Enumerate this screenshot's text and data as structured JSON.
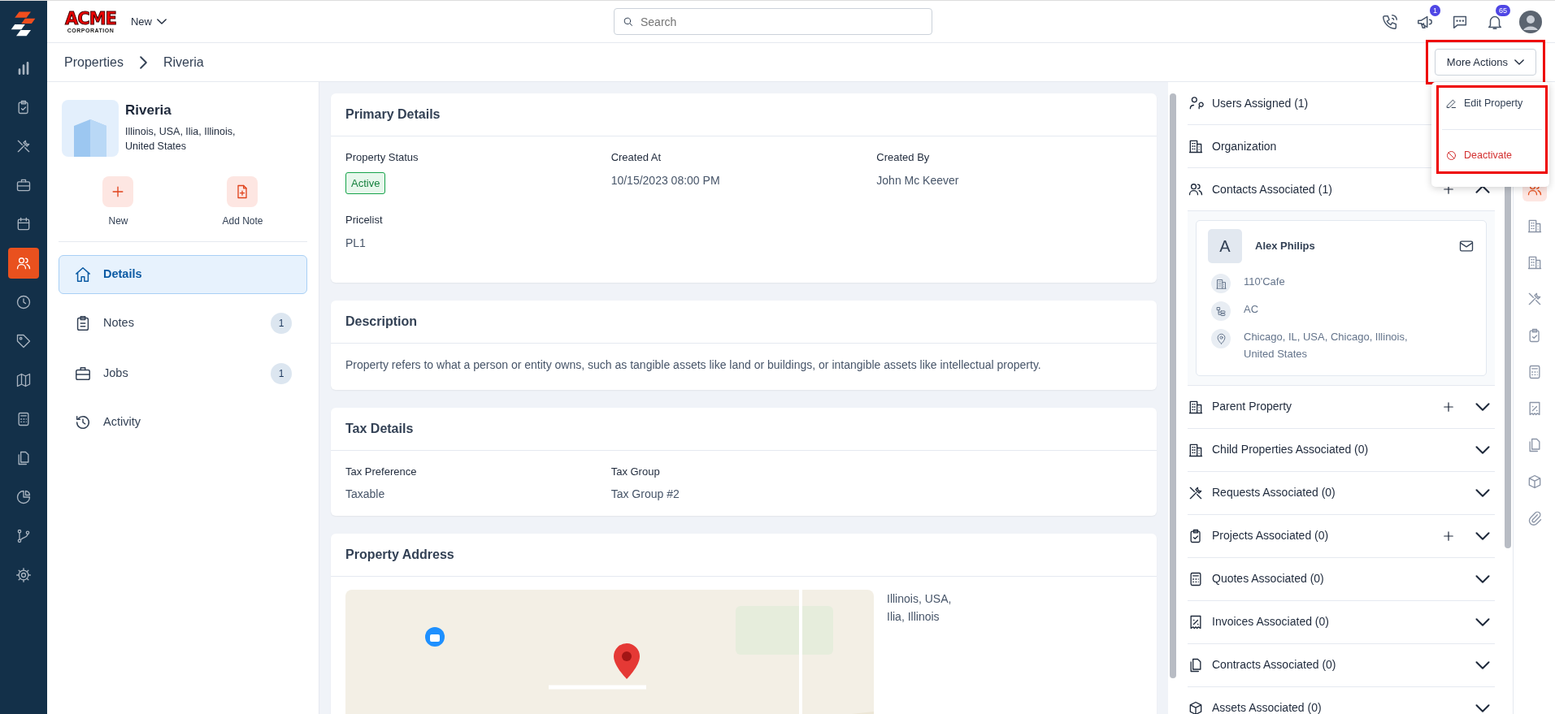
{
  "left_nav": {
    "items": [
      {
        "selected": false
      },
      {
        "selected": false
      },
      {
        "selected": false
      },
      {
        "selected": false
      },
      {
        "selected": false
      },
      {
        "selected": true
      },
      {
        "selected": false
      },
      {
        "selected": false
      },
      {
        "selected": false
      },
      {
        "selected": false
      },
      {
        "selected": false
      },
      {
        "selected": false
      },
      {
        "selected": false
      },
      {
        "selected": false
      }
    ]
  },
  "header": {
    "logo": {
      "text": "ACME",
      "subtext": "CORPORATION"
    },
    "new_menu": "New",
    "search": {
      "placeholder": "Search"
    },
    "icons": [
      {
        "kind": "phone"
      },
      {
        "kind": "megaphone",
        "badge": "1"
      },
      {
        "kind": "chat"
      },
      {
        "kind": "bell",
        "badge": "65"
      }
    ]
  },
  "breadcrumb": [
    "Properties",
    "Riveria"
  ],
  "more_actions": {
    "label": "More Actions",
    "highlighted": true
  },
  "dropdown": {
    "highlighted": true,
    "items": [
      {
        "label": "Edit Property",
        "kind": "normal"
      },
      {
        "label": "Deactivate",
        "kind": "danger"
      }
    ]
  },
  "property": {
    "name": "Riveria",
    "address": "Illinois, USA, Ilia, Illinois, United States"
  },
  "quick_actions": [
    {
      "label": "New"
    },
    {
      "label": "Add Note"
    }
  ],
  "tabs": [
    {
      "label": "Details",
      "selected": true
    },
    {
      "label": "Notes",
      "count": "1",
      "selected": false
    },
    {
      "label": "Jobs",
      "count": "1",
      "selected": false
    },
    {
      "label": "Activity",
      "selected": false
    }
  ],
  "primary_details": {
    "title": "Primary Details",
    "fields": [
      {
        "label": "Property Status",
        "value": "Active",
        "kind": "badge"
      },
      {
        "label": "Created At",
        "value": "10/15/2023 08:00 PM",
        "kind": "text"
      },
      {
        "label": "Created By",
        "value": "John Mc Keever",
        "kind": "text"
      },
      {
        "label": "Pricelist",
        "value": "PL1",
        "kind": "text"
      }
    ]
  },
  "description": {
    "title": "Description",
    "text": "Property refers to what a person or entity owns, such as tangible assets like land or buildings, or intangible assets like intellectual property."
  },
  "tax_details": {
    "title": "Tax Details",
    "fields": [
      {
        "label": "Tax Preference",
        "value": "Taxable"
      },
      {
        "label": "Tax Group",
        "value": "Tax Group #2"
      }
    ]
  },
  "property_address": {
    "title": "Property Address",
    "address": "Illinois, USA, Ilia, Illinois"
  },
  "right_panel": {
    "sections": [
      {
        "title": "Users Assigned (1)",
        "add": false
      },
      {
        "title": "Organization",
        "add": false
      },
      {
        "title": "Contacts Associated (1)",
        "add": true,
        "expanded": true
      },
      {
        "title": "Parent Property",
        "add": true,
        "expanded": false
      },
      {
        "title": "Child Properties Associated (0)",
        "add": false,
        "expanded": false
      },
      {
        "title": "Requests Associated (0)",
        "add": false,
        "expanded": false
      },
      {
        "title": "Projects Associated (0)",
        "add": true,
        "expanded": false
      },
      {
        "title": "Quotes Associated (0)",
        "add": false,
        "expanded": false
      },
      {
        "title": "Invoices Associated (0)",
        "add": false,
        "expanded": false
      },
      {
        "title": "Contracts Associated (0)",
        "add": false,
        "expanded": false
      },
      {
        "title": "Assets Associated (0)",
        "add": false,
        "expanded": false
      }
    ],
    "contact": {
      "initial": "A",
      "name": "Alex Philips",
      "lines": [
        "110'Cafe",
        "AC",
        "Chicago, IL, USA, Chicago, Illinois, United States"
      ]
    }
  },
  "right_rail": {
    "items": [
      {
        "selected": true
      },
      {
        "selected": false
      },
      {
        "selected": false
      },
      {
        "selected": false
      },
      {
        "selected": false
      },
      {
        "selected": false
      },
      {
        "selected": false
      },
      {
        "selected": false
      },
      {
        "selected": false
      },
      {
        "selected": false
      }
    ]
  }
}
